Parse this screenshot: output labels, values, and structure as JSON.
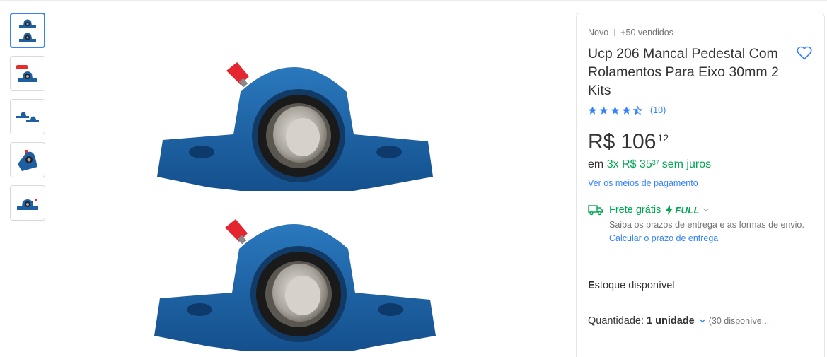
{
  "gallery": {
    "thumbnails": [
      {
        "name": "thumbnail-1",
        "active": true
      },
      {
        "name": "thumbnail-2",
        "active": false
      },
      {
        "name": "thumbnail-3",
        "active": false
      },
      {
        "name": "thumbnail-4",
        "active": false
      },
      {
        "name": "thumbnail-5",
        "active": false
      }
    ]
  },
  "product": {
    "condition": "Novo",
    "sold": "+50 vendidos",
    "title": "Ucp 206 Mancal Pedestal Com Rolamentos Para Eixo 30mm 2 Kits",
    "rating": 4.5,
    "reviews_count": "(10)",
    "price": {
      "currency": "R$",
      "integer": "106",
      "cents": "12"
    },
    "installments": {
      "prefix": "em",
      "count_price": "3x R$ 35",
      "cents": "37",
      "suffix": "sem juros"
    },
    "payment_link": "Ver os meios de pagamento"
  },
  "shipping": {
    "label": "Frete grátis",
    "badge": "FULL",
    "info": "Saiba os prazos de entrega e as formas de envio.",
    "calc_link": "Calcular o prazo de entrega"
  },
  "stock": {
    "first": "E",
    "rest": "stoque disponível"
  },
  "quantity": {
    "label": "Quantidade:",
    "value": "1 unidade",
    "available": "(30 disponíve..."
  },
  "colors": {
    "accent": "#3483fa",
    "green": "#00a650",
    "part_blue": "#1d5fa0"
  }
}
